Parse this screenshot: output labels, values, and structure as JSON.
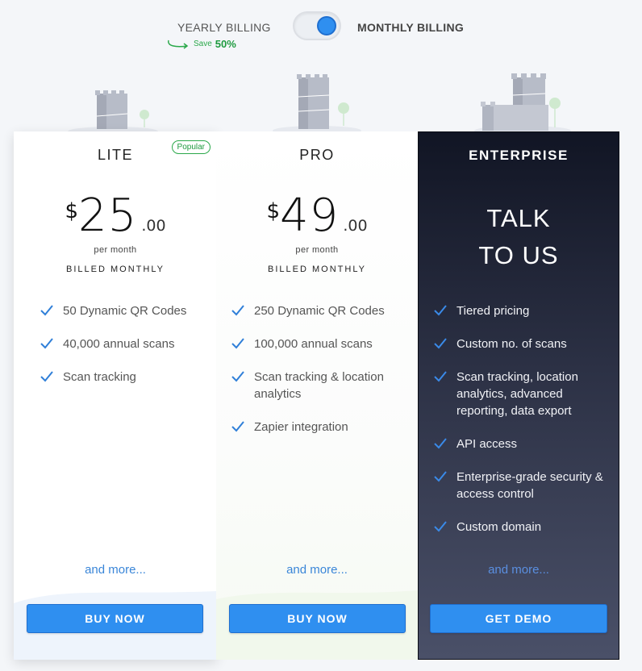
{
  "billing": {
    "yearly_label": "YEARLY BILLING",
    "save_text": "Save",
    "save_percent": "50%",
    "monthly_label": "MONTHLY BILLING",
    "toggle_state": "monthly"
  },
  "colors": {
    "accent": "#2f8ff0",
    "popular_green": "#2aa84a",
    "enterprise_bg_top": "#111524",
    "enterprise_bg_bottom": "#4a5068",
    "check_blue": "#2f7fd8"
  },
  "plans": [
    {
      "name": "LITE",
      "badge": "Popular",
      "currency": "$",
      "amount": "25",
      "cents": ".00",
      "per_month": "per month",
      "billed": "BILLED MONTHLY",
      "features": [
        "50 Dynamic QR Codes",
        "40,000 annual scans",
        "Scan tracking"
      ],
      "and_more": "and more...",
      "button": "BUY NOW"
    },
    {
      "name": "PRO",
      "currency": "$",
      "amount": "49",
      "cents": ".00",
      "per_month": "per month",
      "billed": "BILLED MONTHLY",
      "features": [
        "250 Dynamic QR Codes",
        "100,000 annual scans",
        "Scan tracking & location analytics",
        "Zapier integration"
      ],
      "and_more": "and more...",
      "button": "BUY NOW"
    },
    {
      "name": "ENTERPRISE",
      "talk_line1": "TALK",
      "talk_line2": "TO US",
      "features": [
        "Tiered pricing",
        "Custom no. of scans",
        "Scan tracking, location analytics, advanced reporting, data export",
        "API access",
        "Enterprise-grade security & access control",
        "Custom domain"
      ],
      "and_more": "and more...",
      "button": "GET DEMO"
    }
  ],
  "icons": {
    "check": "check-icon",
    "save_arrow": "curved-arrow-icon",
    "building": "building-illustration"
  }
}
